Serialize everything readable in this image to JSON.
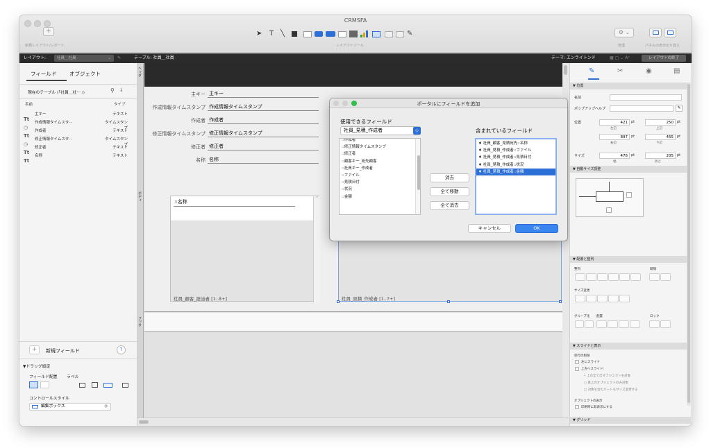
{
  "window": {
    "title": "CRMSFA"
  },
  "toolbar": {
    "new_layout_label": "新規レイアウト/レポート",
    "layout_tools_label": "レイアウトツール",
    "manage_label": "管理",
    "panel_toggle_label": "パネルの表示切り替え"
  },
  "layoutbar": {
    "layout_label": "レイアウト:",
    "layout_value": "社員＿社員",
    "table_label": "テーブル: 社員＿社員",
    "theme_label": "テーマ: エンライトンド",
    "exit_label": "レイアウトの終了"
  },
  "left_panel": {
    "tabs": [
      "フィールド",
      "オブジェクト"
    ],
    "current_table": "現在のテーブル (「社員＿社···",
    "col_name": "名前",
    "col_type": "タイプ",
    "fields": [
      {
        "name": "主キー",
        "type": "テキスト",
        "icon": "text-icon"
      },
      {
        "name": "作成情報タイムスタ···",
        "type": "タイムスタンプ",
        "icon": "timestamp-icon"
      },
      {
        "name": "作成者",
        "type": "テキスト",
        "icon": "text-icon"
      },
      {
        "name": "修正情報タイムスタ···",
        "type": "タイムスタンプ",
        "icon": "timestamp-icon"
      },
      {
        "name": "修正者",
        "type": "テキスト",
        "icon": "text-icon"
      },
      {
        "name": "名称",
        "type": "テキスト",
        "icon": "text-icon"
      }
    ],
    "new_field": "新規フィールド",
    "drag_settings": "▼ドラッグ設定",
    "field_placement": "フィールド配置",
    "label": "ラベル",
    "control_style": "コントロールスタイル",
    "control_value": "編集ボックス"
  },
  "canvas": {
    "header_tab": "ヘッダ",
    "body_tab": "ボディ",
    "footer_tab": "フッタ",
    "fields": [
      {
        "label": "主キー",
        "value": "主キー"
      },
      {
        "label": "作成情報タイムスタンプ",
        "value": "作成情報タイムスタンプ"
      },
      {
        "label": "作成者",
        "value": "作成者"
      },
      {
        "label": "修正情報タイムスタンプ",
        "value": "修正情報タイムスタンプ"
      },
      {
        "label": "修正者",
        "value": "修正者"
      },
      {
        "label": "名称",
        "value": "名称"
      }
    ],
    "portal1_field": "::名称",
    "portal1_caption": "社員_顧客_担当者 [1..8+]",
    "portal2_caption": "社員_見積_作成者 [1..7+]"
  },
  "dialog": {
    "title": "ポータルにフィールドを追加",
    "available_label": "使用できるフィールド",
    "table_select": "社員_見積_作成者",
    "included_label": "含まれているフィールド",
    "available": [
      "::作成者",
      "::修正情報タイムスタンプ",
      "::修正者",
      "::顧客キー_宛先顧客",
      "::社員キー_作成者",
      "::ファイル",
      "::見積日付",
      "::状況",
      "::金額"
    ],
    "included": [
      "社員_顧客_見積宛先::名称",
      "社員_見積_作成者::ファイル",
      "社員_見積_作成者::見積日付",
      "社員_見積_作成者::状況",
      "社員_見積_作成者::金額"
    ],
    "buttons": {
      "clear": "消去",
      "move_all": "全て移動",
      "clear_all": "全て消去",
      "cancel": "キャンセル",
      "ok": "OK"
    }
  },
  "inspector": {
    "pos_section": "▼ 位置",
    "name_label": "名前",
    "popup_help": "ポップアップヘルプ",
    "position": "位置",
    "left": "421",
    "top": "250",
    "right": "897",
    "bottom": "455",
    "left_l": "左辺",
    "top_l": "上辺",
    "right_l": "右辺",
    "bottom_l": "下辺",
    "size": "サイズ",
    "width": "476",
    "height": "205",
    "width_l": "幅",
    "height_l": "高さ",
    "pt": "pt",
    "autosize": "▼ 自動サイズ調整",
    "arrange": "▼ 配置と整列",
    "align": "整列",
    "distribute": "間隔",
    "resize": "サイズ変更",
    "group": "グループ化",
    "arrange2": "配置",
    "lock": "ロック",
    "slide": "▼ スライドと表示",
    "slide_h": "空行の削除",
    "slide_left": "左にスライド",
    "slide_up": "上方へスライド:",
    "opt1": "上の全てのオブジェクトを対象",
    "opt2": "真上のオブジェクトのみ対象",
    "opt3": "対象を含むパートもサイズ変更する",
    "display": "オブジェクトの表示",
    "print_hide": "印刷時に非表示にする",
    "grid": "▼ グリッド"
  }
}
